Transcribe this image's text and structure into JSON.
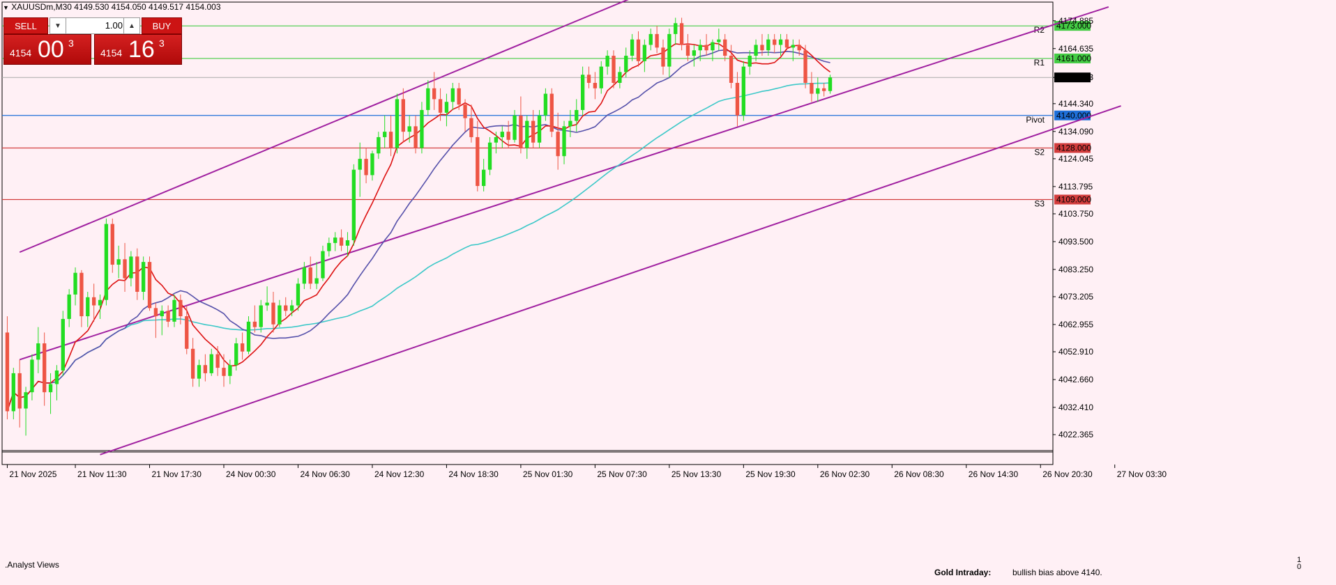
{
  "header": {
    "symbol_info": "XAUUSDm,M30  4149.530 4154.050 4149.517 4154.003"
  },
  "trade_panel": {
    "sell_label": "SELL",
    "buy_label": "BUY",
    "quantity": "1.00",
    "sell_price_small": "4154",
    "sell_price_big": "00",
    "sell_price_sup": "3",
    "buy_price_small": "4154",
    "buy_price_big": "16",
    "buy_price_sup": "3"
  },
  "indicator_pane": {
    "name": "Analyst Views",
    "note_title": "Gold Intraday:",
    "note_text": "bullish bias above 4140.",
    "scale_max": "1",
    "scale_min": "0"
  },
  "chart_data": {
    "type": "candlestick",
    "symbol": "XAUUSDm",
    "timeframe": "M30",
    "ylim": [
      4017.0,
      4181.0
    ],
    "y_ticks": [
      "4174.885",
      "4164.635",
      "4154.003",
      "4144.340",
      "4134.090",
      "4124.045",
      "4113.795",
      "4103.750",
      "4093.500",
      "4083.250",
      "4073.205",
      "4062.955",
      "4052.910",
      "4042.660",
      "4032.410",
      "4022.365"
    ],
    "x_ticks": [
      {
        "label": "21 Nov 2025",
        "i": 0
      },
      {
        "label": "21 Nov 11:30",
        "i": 11
      },
      {
        "label": "21 Nov 17:30",
        "i": 23
      },
      {
        "label": "24 Nov 00:30",
        "i": 35
      },
      {
        "label": "24 Nov 06:30",
        "i": 47
      },
      {
        "label": "24 Nov 12:30",
        "i": 59
      },
      {
        "label": "24 Nov 18:30",
        "i": 71
      },
      {
        "label": "25 Nov 01:30",
        "i": 83
      },
      {
        "label": "25 Nov 07:30",
        "i": 95
      },
      {
        "label": "25 Nov 13:30",
        "i": 107
      },
      {
        "label": "25 Nov 19:30",
        "i": 119
      },
      {
        "label": "26 Nov 02:30",
        "i": 131
      },
      {
        "label": "26 Nov 08:30",
        "i": 143
      },
      {
        "label": "26 Nov 14:30",
        "i": 155
      },
      {
        "label": "26 Nov 20:30",
        "i": 167
      },
      {
        "label": "27 Nov 03:30",
        "i": 179
      }
    ],
    "levels": [
      {
        "name": "R2",
        "value": 4173.0,
        "color": "#44cc44",
        "label": "4173.000"
      },
      {
        "name": "R1",
        "value": 4161.0,
        "color": "#44cc44",
        "label": "4161.000"
      },
      {
        "name": "Pivot",
        "value": 4140.0,
        "color": "#1e6fd9",
        "label": "4140.000"
      },
      {
        "name": "S2",
        "value": 4128.0,
        "color": "#d23c3c",
        "label": "4128.000"
      },
      {
        "name": "S3",
        "value": 4109.0,
        "color": "#d23c3c",
        "label": "4109.000"
      }
    ],
    "current_price": {
      "value": 4154.003,
      "label": "4154.003"
    },
    "channel": {
      "color": "#a020a0",
      "lines": [
        {
          "i1": 2,
          "v1": 4089.6,
          "i2": 126,
          "v2": 4207.0
        },
        {
          "i1": 2,
          "v1": 4050.0,
          "i2": 178,
          "v2": 4180.0
        },
        {
          "i1": 15,
          "v1": 4015.0,
          "i2": 180,
          "v2": 4143.5
        }
      ]
    },
    "ma_colors": {
      "fast": "#dd1111",
      "mid": "#5550aa",
      "slow": "#3cc8c8"
    },
    "candles": [
      {
        "o": 4060,
        "h": 4066,
        "l": 4028,
        "c": 4031
      },
      {
        "o": 4031,
        "h": 4047,
        "l": 4028,
        "c": 4045
      },
      {
        "o": 4045,
        "h": 4050,
        "l": 4025,
        "c": 4032
      },
      {
        "o": 4032,
        "h": 4040,
        "l": 4022,
        "c": 4038
      },
      {
        "o": 4038,
        "h": 4052,
        "l": 4035,
        "c": 4050
      },
      {
        "o": 4050,
        "h": 4062,
        "l": 4045,
        "c": 4056
      },
      {
        "o": 4056,
        "h": 4060,
        "l": 4033,
        "c": 4038
      },
      {
        "o": 4038,
        "h": 4045,
        "l": 4030,
        "c": 4041
      },
      {
        "o": 4041,
        "h": 4048,
        "l": 4035,
        "c": 4046
      },
      {
        "o": 4046,
        "h": 4068,
        "l": 4044,
        "c": 4065
      },
      {
        "o": 4065,
        "h": 4076,
        "l": 4062,
        "c": 4074
      },
      {
        "o": 4074,
        "h": 4084,
        "l": 4070,
        "c": 4082
      },
      {
        "o": 4082,
        "h": 4083,
        "l": 4062,
        "c": 4066
      },
      {
        "o": 4066,
        "h": 4075,
        "l": 4062,
        "c": 4073
      },
      {
        "o": 4073,
        "h": 4078,
        "l": 4064,
        "c": 4070
      },
      {
        "o": 4070,
        "h": 4074,
        "l": 4065,
        "c": 4072
      },
      {
        "o": 4072,
        "h": 4102,
        "l": 4070,
        "c": 4100
      },
      {
        "o": 4100,
        "h": 4102,
        "l": 4082,
        "c": 4085
      },
      {
        "o": 4085,
        "h": 4092,
        "l": 4080,
        "c": 4087
      },
      {
        "o": 4087,
        "h": 4093,
        "l": 4075,
        "c": 4080
      },
      {
        "o": 4080,
        "h": 4090,
        "l": 4077,
        "c": 4088
      },
      {
        "o": 4088,
        "h": 4091,
        "l": 4072,
        "c": 4075
      },
      {
        "o": 4075,
        "h": 4088,
        "l": 4072,
        "c": 4086
      },
      {
        "o": 4086,
        "h": 4088,
        "l": 4068,
        "c": 4069
      },
      {
        "o": 4069,
        "h": 4071,
        "l": 4058,
        "c": 4066
      },
      {
        "o": 4066,
        "h": 4070,
        "l": 4059,
        "c": 4068
      },
      {
        "o": 4068,
        "h": 4070,
        "l": 4062,
        "c": 4064
      },
      {
        "o": 4064,
        "h": 4074,
        "l": 4062,
        "c": 4072
      },
      {
        "o": 4072,
        "h": 4074,
        "l": 4063,
        "c": 4066
      },
      {
        "o": 4066,
        "h": 4070,
        "l": 4052,
        "c": 4054
      },
      {
        "o": 4054,
        "h": 4058,
        "l": 4040,
        "c": 4043
      },
      {
        "o": 4043,
        "h": 4050,
        "l": 4040,
        "c": 4048
      },
      {
        "o": 4048,
        "h": 4052,
        "l": 4042,
        "c": 4045
      },
      {
        "o": 4045,
        "h": 4054,
        "l": 4044,
        "c": 4052
      },
      {
        "o": 4052,
        "h": 4055,
        "l": 4044,
        "c": 4047
      },
      {
        "o": 4047,
        "h": 4052,
        "l": 4040,
        "c": 4044
      },
      {
        "o": 4044,
        "h": 4050,
        "l": 4041,
        "c": 4048
      },
      {
        "o": 4048,
        "h": 4058,
        "l": 4046,
        "c": 4056
      },
      {
        "o": 4056,
        "h": 4060,
        "l": 4050,
        "c": 4053
      },
      {
        "o": 4053,
        "h": 4066,
        "l": 4052,
        "c": 4064
      },
      {
        "o": 4064,
        "h": 4070,
        "l": 4060,
        "c": 4062
      },
      {
        "o": 4062,
        "h": 4072,
        "l": 4060,
        "c": 4070
      },
      {
        "o": 4070,
        "h": 4077,
        "l": 4068,
        "c": 4071
      },
      {
        "o": 4071,
        "h": 4075,
        "l": 4060,
        "c": 4063
      },
      {
        "o": 4063,
        "h": 4072,
        "l": 4062,
        "c": 4070
      },
      {
        "o": 4070,
        "h": 4073,
        "l": 4066,
        "c": 4068
      },
      {
        "o": 4068,
        "h": 4072,
        "l": 4066,
        "c": 4070
      },
      {
        "o": 4070,
        "h": 4080,
        "l": 4068,
        "c": 4078
      },
      {
        "o": 4078,
        "h": 4086,
        "l": 4076,
        "c": 4084
      },
      {
        "o": 4084,
        "h": 4088,
        "l": 4076,
        "c": 4078
      },
      {
        "o": 4078,
        "h": 4086,
        "l": 4076,
        "c": 4080
      },
      {
        "o": 4080,
        "h": 4092,
        "l": 4079,
        "c": 4090
      },
      {
        "o": 4090,
        "h": 4095,
        "l": 4088,
        "c": 4093
      },
      {
        "o": 4093,
        "h": 4097,
        "l": 4090,
        "c": 4095
      },
      {
        "o": 4095,
        "h": 4098,
        "l": 4090,
        "c": 4092
      },
      {
        "o": 4092,
        "h": 4097,
        "l": 4088,
        "c": 4094
      },
      {
        "o": 4094,
        "h": 4122,
        "l": 4092,
        "c": 4120
      },
      {
        "o": 4120,
        "h": 4130,
        "l": 4110,
        "c": 4124
      },
      {
        "o": 4124,
        "h": 4128,
        "l": 4115,
        "c": 4118
      },
      {
        "o": 4118,
        "h": 4127,
        "l": 4116,
        "c": 4126
      },
      {
        "o": 4126,
        "h": 4134,
        "l": 4124,
        "c": 4132
      },
      {
        "o": 4132,
        "h": 4140,
        "l": 4128,
        "c": 4134
      },
      {
        "o": 4134,
        "h": 4140,
        "l": 4125,
        "c": 4128
      },
      {
        "o": 4128,
        "h": 4148,
        "l": 4126,
        "c": 4146
      },
      {
        "o": 4146,
        "h": 4150,
        "l": 4130,
        "c": 4134
      },
      {
        "o": 4134,
        "h": 4140,
        "l": 4130,
        "c": 4136
      },
      {
        "o": 4136,
        "h": 4140,
        "l": 4126,
        "c": 4128
      },
      {
        "o": 4128,
        "h": 4145,
        "l": 4126,
        "c": 4142
      },
      {
        "o": 4142,
        "h": 4153,
        "l": 4140,
        "c": 4150
      },
      {
        "o": 4150,
        "h": 4156,
        "l": 4142,
        "c": 4146
      },
      {
        "o": 4146,
        "h": 4150,
        "l": 4138,
        "c": 4141
      },
      {
        "o": 4141,
        "h": 4148,
        "l": 4136,
        "c": 4145
      },
      {
        "o": 4145,
        "h": 4152,
        "l": 4142,
        "c": 4150
      },
      {
        "o": 4150,
        "h": 4152,
        "l": 4142,
        "c": 4144
      },
      {
        "o": 4144,
        "h": 4146,
        "l": 4134,
        "c": 4139
      },
      {
        "o": 4139,
        "h": 4144,
        "l": 4130,
        "c": 4132
      },
      {
        "o": 4132,
        "h": 4138,
        "l": 4112,
        "c": 4114
      },
      {
        "o": 4114,
        "h": 4124,
        "l": 4112,
        "c": 4120
      },
      {
        "o": 4120,
        "h": 4132,
        "l": 4118,
        "c": 4130
      },
      {
        "o": 4130,
        "h": 4134,
        "l": 4126,
        "c": 4132
      },
      {
        "o": 4132,
        "h": 4136,
        "l": 4128,
        "c": 4134
      },
      {
        "o": 4134,
        "h": 4138,
        "l": 4128,
        "c": 4131
      },
      {
        "o": 4131,
        "h": 4142,
        "l": 4130,
        "c": 4140
      },
      {
        "o": 4140,
        "h": 4147,
        "l": 4126,
        "c": 4128
      },
      {
        "o": 4128,
        "h": 4140,
        "l": 4124,
        "c": 4138
      },
      {
        "o": 4138,
        "h": 4142,
        "l": 4128,
        "c": 4130
      },
      {
        "o": 4130,
        "h": 4142,
        "l": 4128,
        "c": 4140
      },
      {
        "o": 4140,
        "h": 4150,
        "l": 4138,
        "c": 4148
      },
      {
        "o": 4148,
        "h": 4150,
        "l": 4132,
        "c": 4134
      },
      {
        "o": 4134,
        "h": 4141,
        "l": 4120,
        "c": 4125
      },
      {
        "o": 4125,
        "h": 4138,
        "l": 4122,
        "c": 4136
      },
      {
        "o": 4136,
        "h": 4142,
        "l": 4132,
        "c": 4138
      },
      {
        "o": 4138,
        "h": 4146,
        "l": 4134,
        "c": 4142
      },
      {
        "o": 4142,
        "h": 4158,
        "l": 4140,
        "c": 4155
      },
      {
        "o": 4155,
        "h": 4158,
        "l": 4150,
        "c": 4152
      },
      {
        "o": 4152,
        "h": 4156,
        "l": 4146,
        "c": 4150
      },
      {
        "o": 4150,
        "h": 4160,
        "l": 4148,
        "c": 4158
      },
      {
        "o": 4158,
        "h": 4164,
        "l": 4155,
        "c": 4162
      },
      {
        "o": 4162,
        "h": 4164,
        "l": 4150,
        "c": 4152
      },
      {
        "o": 4152,
        "h": 4158,
        "l": 4150,
        "c": 4156
      },
      {
        "o": 4156,
        "h": 4165,
        "l": 4154,
        "c": 4162
      },
      {
        "o": 4162,
        "h": 4170,
        "l": 4160,
        "c": 4168
      },
      {
        "o": 4168,
        "h": 4171,
        "l": 4158,
        "c": 4160
      },
      {
        "o": 4160,
        "h": 4168,
        "l": 4156,
        "c": 4166
      },
      {
        "o": 4166,
        "h": 4172,
        "l": 4164,
        "c": 4170
      },
      {
        "o": 4170,
        "h": 4173,
        "l": 4163,
        "c": 4165
      },
      {
        "o": 4165,
        "h": 4168,
        "l": 4155,
        "c": 4158
      },
      {
        "o": 4158,
        "h": 4172,
        "l": 4154,
        "c": 4170
      },
      {
        "o": 4170,
        "h": 4176,
        "l": 4166,
        "c": 4174
      },
      {
        "o": 4174,
        "h": 4176,
        "l": 4164,
        "c": 4166
      },
      {
        "o": 4166,
        "h": 4170,
        "l": 4160,
        "c": 4162
      },
      {
        "o": 4162,
        "h": 4166,
        "l": 4158,
        "c": 4164
      },
      {
        "o": 4164,
        "h": 4168,
        "l": 4160,
        "c": 4166
      },
      {
        "o": 4166,
        "h": 4170,
        "l": 4162,
        "c": 4164
      },
      {
        "o": 4164,
        "h": 4168,
        "l": 4160,
        "c": 4167
      },
      {
        "o": 4167,
        "h": 4172,
        "l": 4164,
        "c": 4168
      },
      {
        "o": 4168,
        "h": 4170,
        "l": 4160,
        "c": 4162
      },
      {
        "o": 4162,
        "h": 4166,
        "l": 4150,
        "c": 4152
      },
      {
        "o": 4152,
        "h": 4156,
        "l": 4136,
        "c": 4140
      },
      {
        "o": 4140,
        "h": 4160,
        "l": 4138,
        "c": 4158
      },
      {
        "o": 4158,
        "h": 4164,
        "l": 4155,
        "c": 4162
      },
      {
        "o": 4162,
        "h": 4168,
        "l": 4160,
        "c": 4166
      },
      {
        "o": 4166,
        "h": 4170,
        "l": 4162,
        "c": 4164
      },
      {
        "o": 4164,
        "h": 4170,
        "l": 4162,
        "c": 4168
      },
      {
        "o": 4168,
        "h": 4170,
        "l": 4163,
        "c": 4166
      },
      {
        "o": 4166,
        "h": 4170,
        "l": 4162,
        "c": 4168
      },
      {
        "o": 4168,
        "h": 4170,
        "l": 4164,
        "c": 4165
      },
      {
        "o": 4165,
        "h": 4168,
        "l": 4160,
        "c": 4166
      },
      {
        "o": 4166,
        "h": 4168,
        "l": 4162,
        "c": 4164
      },
      {
        "o": 4164,
        "h": 4166,
        "l": 4150,
        "c": 4152
      },
      {
        "o": 4152,
        "h": 4156,
        "l": 4145,
        "c": 4148
      },
      {
        "o": 4148,
        "h": 4154,
        "l": 4145,
        "c": 4150
      },
      {
        "o": 4150,
        "h": 4152,
        "l": 4147,
        "c": 4149
      },
      {
        "o": 4149,
        "h": 4155,
        "l": 4148,
        "c": 4154
      }
    ]
  }
}
